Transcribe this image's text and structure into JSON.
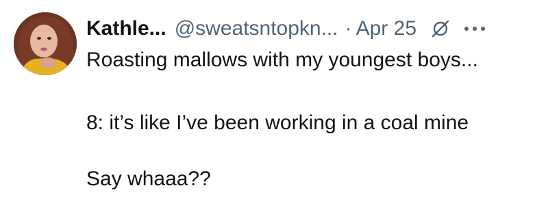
{
  "tweet": {
    "author": {
      "display_name": "Kathle...",
      "handle": "@sweatsntopkn...",
      "avatar_icon": "user-avatar-photo"
    },
    "separator": "·",
    "date": "Apr 25",
    "icons": {
      "grok": "grok-slash-circle-icon",
      "more": "more-options-icon"
    },
    "text_lines": [
      "Roasting mallows with my youngest boys...",
      "8: it’s like I’ve been working in a coal mine",
      "Say whaaa??"
    ]
  },
  "colors": {
    "text_primary": "#0f1419",
    "text_secondary": "#536471"
  }
}
